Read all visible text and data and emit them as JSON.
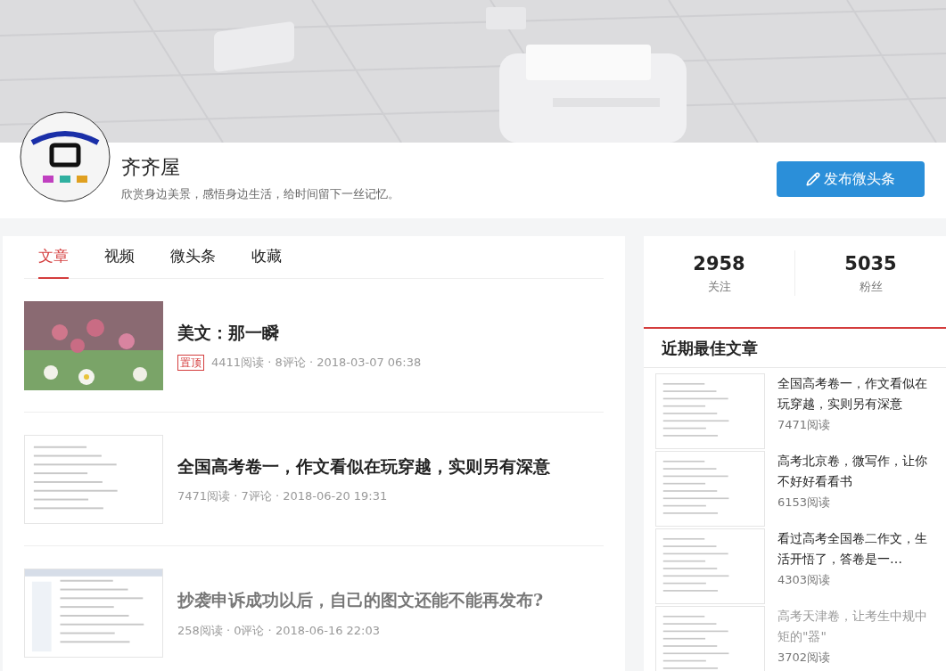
{
  "profile": {
    "name": "齐齐屋",
    "motto": "欣赏身边美景，感悟身边生活，给时间留下一丝记忆。",
    "publish_button": "发布微头条"
  },
  "tabs": [
    {
      "label": "文章",
      "selected": true
    },
    {
      "label": "视频",
      "selected": false
    },
    {
      "label": "微头条",
      "selected": false
    },
    {
      "label": "收藏",
      "selected": false
    }
  ],
  "articles": [
    {
      "title": "美文：那一瞬",
      "pinned_badge": "置顶",
      "meta": "4411阅读 · 8评论 · 2018-03-07 06:38",
      "visited": false
    },
    {
      "title": "全国高考卷一，作文看似在玩穿越，实则另有深意",
      "meta": "7471阅读 · 7评论 · 2018-06-20 19:31",
      "visited": false
    },
    {
      "title": "抄袭申诉成功以后，自己的图文还能不能再发布?",
      "meta": "258阅读 · 0评论 · 2018-06-16 22:03",
      "visited": true
    }
  ],
  "stats": [
    {
      "value": "2958",
      "label": "关注"
    },
    {
      "value": "5035",
      "label": "粉丝"
    }
  ],
  "best": {
    "heading": "近期最佳文章",
    "items": [
      {
        "title": "全国高考卷一，作文看似在玩穿越，实则另有深意",
        "reads": "7471阅读",
        "visited": false
      },
      {
        "title": "高考北京卷，微写作，让你不好好看看书",
        "reads": "6153阅读",
        "visited": false
      },
      {
        "title": "看过高考全国卷二作文，生活开悟了，答卷是一…",
        "reads": "4303阅读",
        "visited": false
      },
      {
        "title": "高考天津卷，让考生中规中矩的\"器\"",
        "reads": "3702阅读",
        "visited": true
      }
    ]
  }
}
